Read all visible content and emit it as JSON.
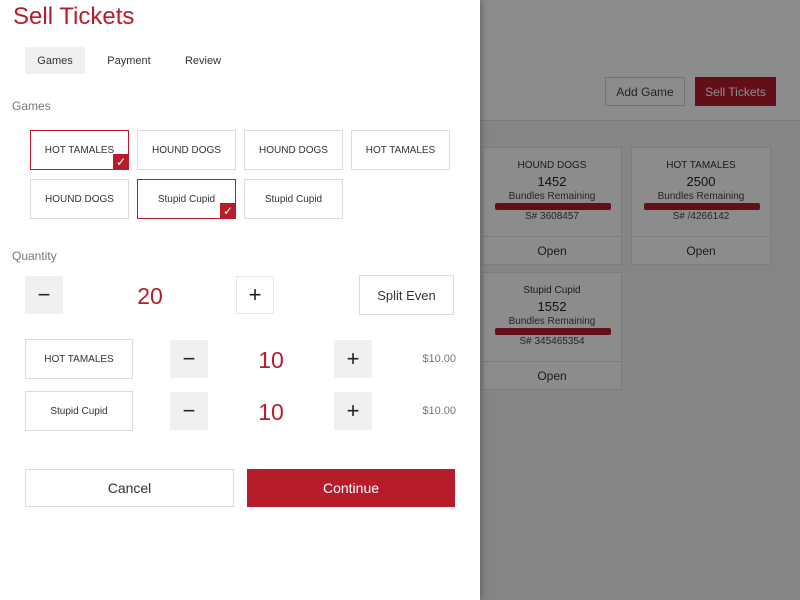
{
  "background": {
    "add_game_label": "Add Game",
    "sell_tickets_label": "Sell Tickets",
    "cards": [
      {
        "name": "HOUND DOGS",
        "count": "1452",
        "bundles_label": "Bundles Remaining",
        "serial": "S# 3608457",
        "open_label": "Open"
      },
      {
        "name": "HOT TAMALES",
        "count": "2500",
        "bundles_label": "Bundles Remaining",
        "serial": "S# /4266142",
        "open_label": "Open"
      },
      {
        "name": "Stupid Cupid",
        "count": "1552",
        "bundles_label": "Bundles Remaining",
        "serial": "S# 345465354",
        "open_label": "Open"
      }
    ]
  },
  "drawer": {
    "title": "Sell Tickets",
    "tabs": [
      {
        "label": "Games",
        "active": true
      },
      {
        "label": "Payment",
        "active": false
      },
      {
        "label": "Review",
        "active": false
      }
    ],
    "games_label": "Games",
    "games": [
      {
        "label": "HOT TAMALES",
        "selected": true
      },
      {
        "label": "HOUND DOGS",
        "selected": false
      },
      {
        "label": "HOUND DOGS",
        "selected": false
      },
      {
        "label": "HOT TAMALES",
        "selected": false
      },
      {
        "label": "HOUND DOGS",
        "selected": false
      },
      {
        "label": "Stupid Cupid",
        "selected": true
      },
      {
        "label": "Stupid Cupid",
        "selected": false
      }
    ],
    "check_glyph": "✓",
    "quantity_label": "Quantity",
    "total_quantity": "20",
    "minus_glyph": "−",
    "plus_glyph": "+",
    "split_even_label": "Split Even",
    "lines": [
      {
        "name": "HOT TAMALES",
        "quantity": "10",
        "price": "$10.00"
      },
      {
        "name": "Stupid Cupid",
        "quantity": "10",
        "price": "$10.00"
      }
    ],
    "cancel_label": "Cancel",
    "continue_label": "Continue"
  },
  "colors": {
    "accent": "#b71c2b",
    "overlay": "rgba(0,0,0,0.45)"
  }
}
